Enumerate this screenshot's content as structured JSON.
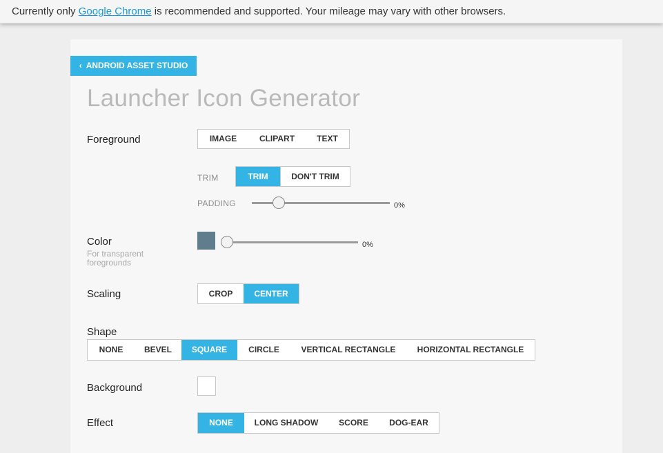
{
  "banner": {
    "prefix": "Currently only",
    "link": "Google Chrome",
    "suffix": "is recommended and supported. Your mileage may vary with other browsers."
  },
  "header": {
    "back_label": "ANDROID ASSET STUDIO",
    "back_icon": "chevron-left-icon",
    "title": "Launcher Icon Generator"
  },
  "form": {
    "foreground": {
      "label": "Foreground",
      "options": [
        "IMAGE",
        "CLIPART",
        "TEXT"
      ]
    },
    "trim": {
      "label": "TRIM",
      "options": [
        "TRIM",
        "DON'T TRIM"
      ],
      "selected": "TRIM"
    },
    "padding": {
      "label": "PADDING",
      "value": 0,
      "value_text": "0%"
    },
    "color": {
      "label": "Color",
      "sublabel": "For transparent foregrounds",
      "swatch": "#5f7d8c",
      "value": 0,
      "value_text": "0%"
    },
    "scaling": {
      "label": "Scaling",
      "options": [
        "CROP",
        "CENTER"
      ],
      "selected": "CENTER"
    },
    "shape": {
      "label": "Shape",
      "options": [
        "NONE",
        "BEVEL",
        "SQUARE",
        "CIRCLE",
        "VERTICAL RECTANGLE",
        "HORIZONTAL RECTANGLE"
      ],
      "selected": "SQUARE"
    },
    "background": {
      "label": "Background",
      "swatch": "#ffffff"
    },
    "effect": {
      "label": "Effect",
      "options": [
        "NONE",
        "LONG SHADOW",
        "SCORE",
        "DOG-EAR"
      ],
      "selected": "NONE"
    }
  },
  "colors": {
    "accent": "#33b4e5",
    "link": "#1a9ad6"
  }
}
